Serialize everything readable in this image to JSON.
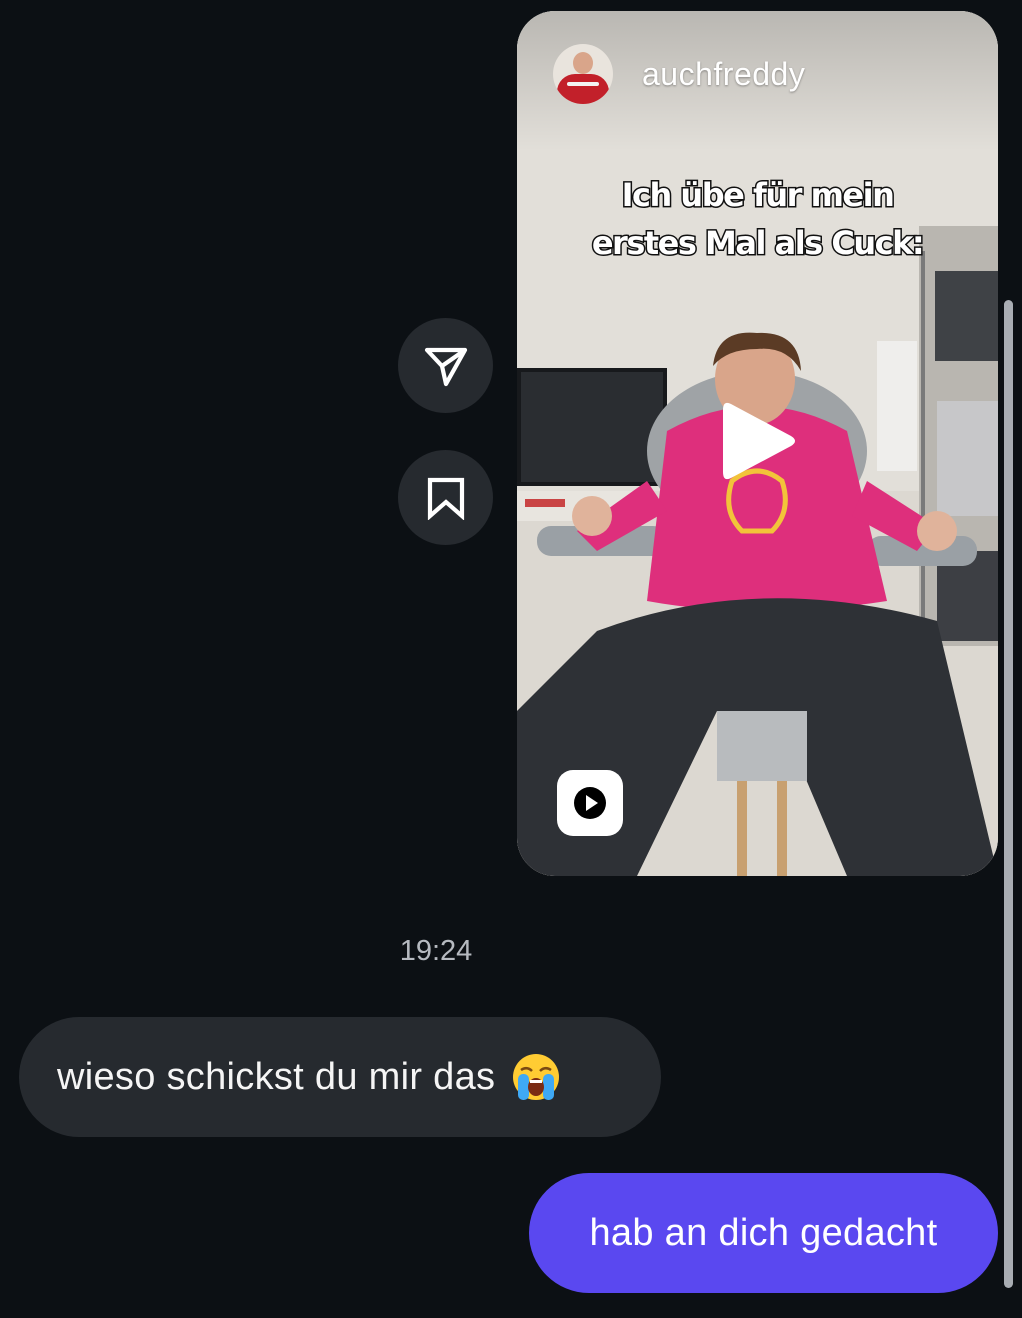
{
  "reel": {
    "username": "auchfreddy",
    "caption_line1": "Ich übe für mein",
    "caption_line2": "erstes Mal als Cuck:"
  },
  "actions": {
    "share_icon": "send-icon",
    "save_icon": "bookmark-icon"
  },
  "messages": {
    "timestamp": "19:24",
    "incoming_text": "wieso schickst du mir das",
    "incoming_emoji": "loudly-crying-face",
    "outgoing_text": "hab an dich gedacht"
  },
  "colors": {
    "background": "#0c1014",
    "incoming_bubble": "#262a2f",
    "outgoing_bubble": "#5a48f0"
  }
}
